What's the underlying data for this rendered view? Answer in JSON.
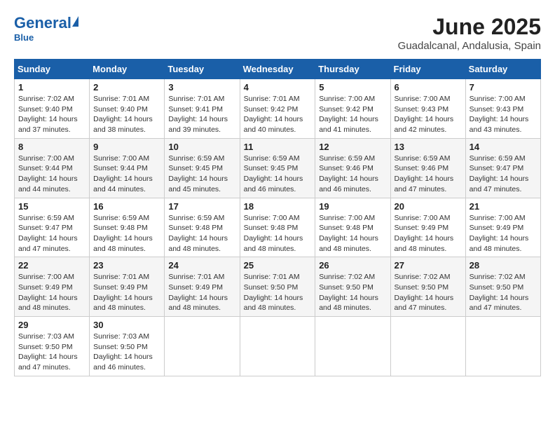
{
  "header": {
    "logo_general": "General",
    "logo_blue": "Blue",
    "month_title": "June 2025",
    "location": "Guadalcanal, Andalusia, Spain"
  },
  "calendar": {
    "days_of_week": [
      "Sunday",
      "Monday",
      "Tuesday",
      "Wednesday",
      "Thursday",
      "Friday",
      "Saturday"
    ],
    "weeks": [
      [
        null,
        {
          "day": "2",
          "sunrise": "Sunrise: 7:01 AM",
          "sunset": "Sunset: 9:40 PM",
          "daylight": "Daylight: 14 hours and 38 minutes."
        },
        {
          "day": "3",
          "sunrise": "Sunrise: 7:01 AM",
          "sunset": "Sunset: 9:41 PM",
          "daylight": "Daylight: 14 hours and 39 minutes."
        },
        {
          "day": "4",
          "sunrise": "Sunrise: 7:01 AM",
          "sunset": "Sunset: 9:42 PM",
          "daylight": "Daylight: 14 hours and 40 minutes."
        },
        {
          "day": "5",
          "sunrise": "Sunrise: 7:00 AM",
          "sunset": "Sunset: 9:42 PM",
          "daylight": "Daylight: 14 hours and 41 minutes."
        },
        {
          "day": "6",
          "sunrise": "Sunrise: 7:00 AM",
          "sunset": "Sunset: 9:43 PM",
          "daylight": "Daylight: 14 hours and 42 minutes."
        },
        {
          "day": "7",
          "sunrise": "Sunrise: 7:00 AM",
          "sunset": "Sunset: 9:43 PM",
          "daylight": "Daylight: 14 hours and 43 minutes."
        }
      ],
      [
        {
          "day": "1",
          "sunrise": "Sunrise: 7:02 AM",
          "sunset": "Sunset: 9:40 PM",
          "daylight": "Daylight: 14 hours and 37 minutes."
        },
        null,
        null,
        null,
        null,
        null,
        null
      ],
      [
        {
          "day": "8",
          "sunrise": "Sunrise: 7:00 AM",
          "sunset": "Sunset: 9:44 PM",
          "daylight": "Daylight: 14 hours and 44 minutes."
        },
        {
          "day": "9",
          "sunrise": "Sunrise: 7:00 AM",
          "sunset": "Sunset: 9:44 PM",
          "daylight": "Daylight: 14 hours and 44 minutes."
        },
        {
          "day": "10",
          "sunrise": "Sunrise: 6:59 AM",
          "sunset": "Sunset: 9:45 PM",
          "daylight": "Daylight: 14 hours and 45 minutes."
        },
        {
          "day": "11",
          "sunrise": "Sunrise: 6:59 AM",
          "sunset": "Sunset: 9:45 PM",
          "daylight": "Daylight: 14 hours and 46 minutes."
        },
        {
          "day": "12",
          "sunrise": "Sunrise: 6:59 AM",
          "sunset": "Sunset: 9:46 PM",
          "daylight": "Daylight: 14 hours and 46 minutes."
        },
        {
          "day": "13",
          "sunrise": "Sunrise: 6:59 AM",
          "sunset": "Sunset: 9:46 PM",
          "daylight": "Daylight: 14 hours and 47 minutes."
        },
        {
          "day": "14",
          "sunrise": "Sunrise: 6:59 AM",
          "sunset": "Sunset: 9:47 PM",
          "daylight": "Daylight: 14 hours and 47 minutes."
        }
      ],
      [
        {
          "day": "15",
          "sunrise": "Sunrise: 6:59 AM",
          "sunset": "Sunset: 9:47 PM",
          "daylight": "Daylight: 14 hours and 47 minutes."
        },
        {
          "day": "16",
          "sunrise": "Sunrise: 6:59 AM",
          "sunset": "Sunset: 9:48 PM",
          "daylight": "Daylight: 14 hours and 48 minutes."
        },
        {
          "day": "17",
          "sunrise": "Sunrise: 6:59 AM",
          "sunset": "Sunset: 9:48 PM",
          "daylight": "Daylight: 14 hours and 48 minutes."
        },
        {
          "day": "18",
          "sunrise": "Sunrise: 7:00 AM",
          "sunset": "Sunset: 9:48 PM",
          "daylight": "Daylight: 14 hours and 48 minutes."
        },
        {
          "day": "19",
          "sunrise": "Sunrise: 7:00 AM",
          "sunset": "Sunset: 9:48 PM",
          "daylight": "Daylight: 14 hours and 48 minutes."
        },
        {
          "day": "20",
          "sunrise": "Sunrise: 7:00 AM",
          "sunset": "Sunset: 9:49 PM",
          "daylight": "Daylight: 14 hours and 48 minutes."
        },
        {
          "day": "21",
          "sunrise": "Sunrise: 7:00 AM",
          "sunset": "Sunset: 9:49 PM",
          "daylight": "Daylight: 14 hours and 48 minutes."
        }
      ],
      [
        {
          "day": "22",
          "sunrise": "Sunrise: 7:00 AM",
          "sunset": "Sunset: 9:49 PM",
          "daylight": "Daylight: 14 hours and 48 minutes."
        },
        {
          "day": "23",
          "sunrise": "Sunrise: 7:01 AM",
          "sunset": "Sunset: 9:49 PM",
          "daylight": "Daylight: 14 hours and 48 minutes."
        },
        {
          "day": "24",
          "sunrise": "Sunrise: 7:01 AM",
          "sunset": "Sunset: 9:49 PM",
          "daylight": "Daylight: 14 hours and 48 minutes."
        },
        {
          "day": "25",
          "sunrise": "Sunrise: 7:01 AM",
          "sunset": "Sunset: 9:50 PM",
          "daylight": "Daylight: 14 hours and 48 minutes."
        },
        {
          "day": "26",
          "sunrise": "Sunrise: 7:02 AM",
          "sunset": "Sunset: 9:50 PM",
          "daylight": "Daylight: 14 hours and 48 minutes."
        },
        {
          "day": "27",
          "sunrise": "Sunrise: 7:02 AM",
          "sunset": "Sunset: 9:50 PM",
          "daylight": "Daylight: 14 hours and 47 minutes."
        },
        {
          "day": "28",
          "sunrise": "Sunrise: 7:02 AM",
          "sunset": "Sunset: 9:50 PM",
          "daylight": "Daylight: 14 hours and 47 minutes."
        }
      ],
      [
        {
          "day": "29",
          "sunrise": "Sunrise: 7:03 AM",
          "sunset": "Sunset: 9:50 PM",
          "daylight": "Daylight: 14 hours and 47 minutes."
        },
        {
          "day": "30",
          "sunrise": "Sunrise: 7:03 AM",
          "sunset": "Sunset: 9:50 PM",
          "daylight": "Daylight: 14 hours and 46 minutes."
        },
        null,
        null,
        null,
        null,
        null
      ]
    ]
  }
}
